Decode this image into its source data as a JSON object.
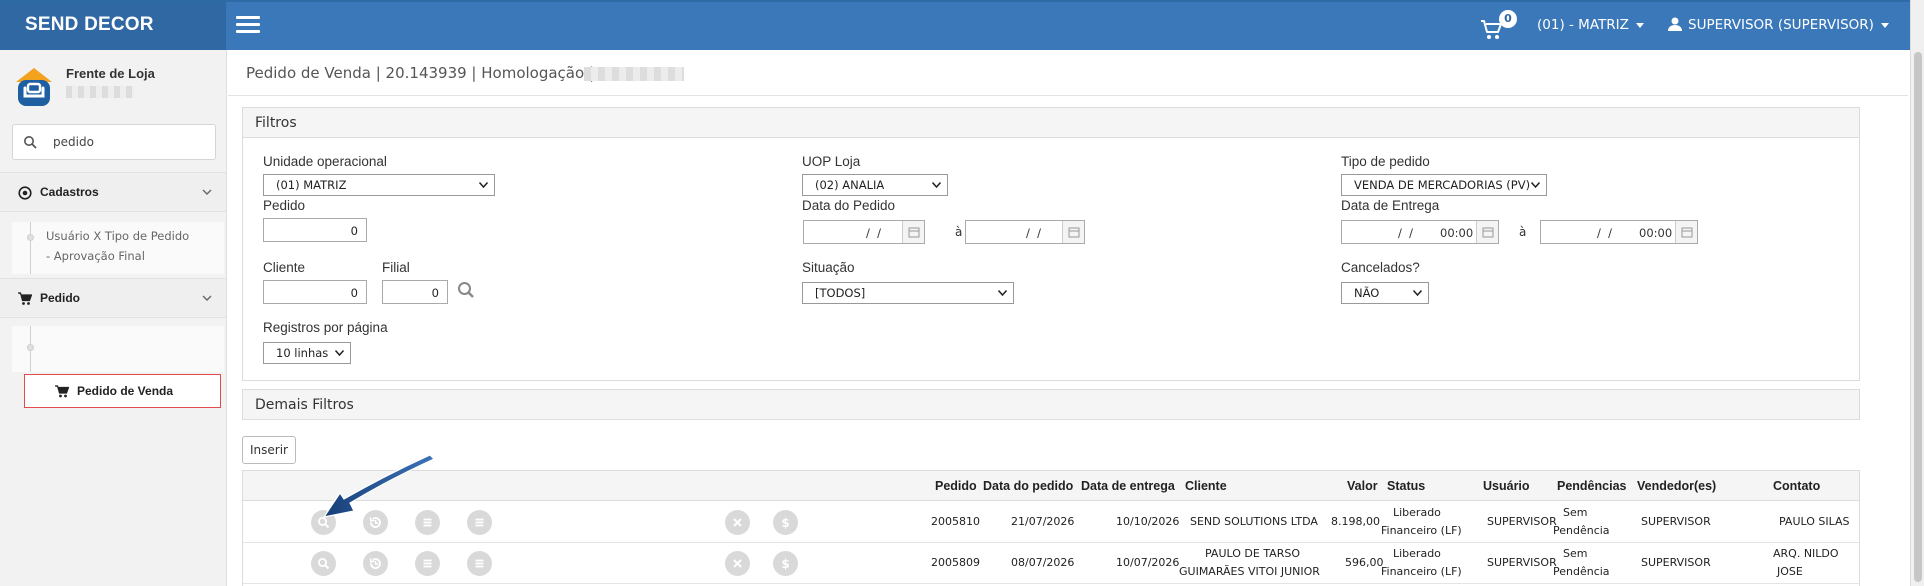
{
  "topbar": {
    "brand": "SEND DECOR",
    "cart_count": "0",
    "unit_selector": "(01) - MATRIZ",
    "user_menu": "SUPERVISOR (SUPERVISOR)"
  },
  "sidebar": {
    "profile_name": "Frente de Loja",
    "search_value": "pedido",
    "sections": [
      {
        "label": "Cadastros",
        "items": [
          "Usuário X Tipo de Pedido - Aprovação Final"
        ]
      },
      {
        "label": "Pedido",
        "items": [
          "Pedido de Venda"
        ]
      }
    ]
  },
  "header": {
    "title": "Pedido de Venda | 20.143939 | Homologação |"
  },
  "filtros": {
    "title": "Filtros",
    "unidade_label": "Unidade operacional",
    "unidade_value": "(01) MATRIZ",
    "uop_label": "UOP Loja",
    "uop_value": "(02) ANALIA",
    "tipo_label": "Tipo de pedido",
    "tipo_value": "VENDA DE MERCADORIAS (PV)",
    "pedido_label": "Pedido",
    "pedido_value": "0",
    "data_pedido_label": "Data do Pedido",
    "data_entrega_label": "Data de Entrega",
    "date_mask": "/  /",
    "time_value": "00:00",
    "ate": "à",
    "cliente_label": "Cliente",
    "cliente_value": "0",
    "filial_label": "Filial",
    "filial_value": "0",
    "situacao_label": "Situação",
    "situacao_value": "[TODOS]",
    "cancelados_label": "Cancelados?",
    "cancelados_value": "NÃO",
    "registros_label": "Registros por página",
    "registros_value": "10 linhas"
  },
  "demais": {
    "title": "Demais Filtros"
  },
  "actions": {
    "insert_label": "Inserir"
  },
  "table": {
    "headers": [
      "Pedido",
      "Data do pedido",
      "Data de entrega",
      "Cliente",
      "Valor",
      "Status",
      "Usuário",
      "Pendências",
      "Vendedor(es)",
      "Contato"
    ],
    "rows": [
      {
        "pedido": "2005810",
        "data_pedido": "21/07/2026",
        "data_entrega": "10/10/2026",
        "cliente": [
          "SEND SOLUTIONS LTDA"
        ],
        "valor": "8.198,00",
        "status": [
          "Liberado",
          "Financeiro (LF)"
        ],
        "usuario": "SUPERVISOR",
        "pendencias": [
          "Sem",
          "Pendência"
        ],
        "vendedor": "SUPERVISOR",
        "contato": [
          "PAULO SILAS"
        ]
      },
      {
        "pedido": "2005809",
        "data_pedido": "08/07/2026",
        "data_entrega": "10/07/2026",
        "cliente": [
          "PAULO DE TARSO",
          "GUIMARÃES VITOI JUNIOR"
        ],
        "valor": "596,00",
        "status": [
          "Liberado",
          "Financeiro (LF)"
        ],
        "usuario": "SUPERVISOR",
        "pendencias": [
          "Sem",
          "Pendência"
        ],
        "vendedor": "SUPERVISOR",
        "contato": [
          "ARQ. NILDO",
          "JOSE"
        ]
      }
    ]
  },
  "colors": {
    "topbar": "#3a78b9",
    "brand": "#2f68a3",
    "highlight": "#e24c4c",
    "arrow": "#1f4f8f"
  }
}
